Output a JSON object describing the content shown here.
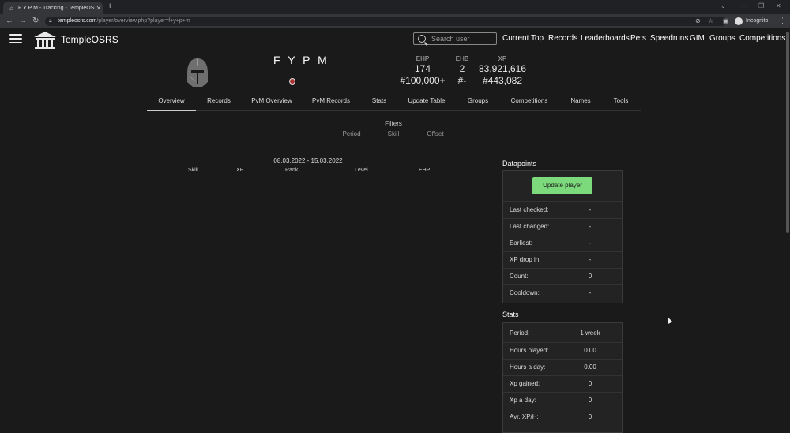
{
  "browser": {
    "tab_title": "F Y P M - Tracking - TempleOSRS",
    "url_host": "templeosrs.com",
    "url_path": "/player/overview.php?player=f+y+p+m",
    "incognito_label": "Incognito"
  },
  "site": {
    "brand": "TempleOSRS",
    "search_placeholder": "Search user",
    "nav": [
      "Current Top",
      "Records",
      "Leaderboards",
      "Pets",
      "Speedruns",
      "GIM",
      "Groups",
      "Competitions"
    ]
  },
  "player": {
    "name": "F Y P M",
    "stats": [
      {
        "label": "EHP",
        "value": "174",
        "rank": "#100,000+"
      },
      {
        "label": "EHB",
        "value": "2",
        "rank": "#-"
      },
      {
        "label": "XP",
        "value": "83,921,616",
        "rank": "#443,082"
      }
    ]
  },
  "tabs": [
    "Overview",
    "Records",
    "PvM Overview",
    "PvM Records",
    "Stats",
    "Update Table",
    "Groups",
    "Competitions",
    "Names",
    "Tools"
  ],
  "filters": {
    "title": "Filters",
    "items": [
      "Period",
      "Skill",
      "Offset"
    ]
  },
  "table": {
    "date_range": "08.03.2022 - 15.03.2022",
    "columns": [
      "Skill",
      "XP",
      "Rank",
      "Level",
      "EHP"
    ]
  },
  "datapoints": {
    "title": "Datapoints",
    "button": "Update player",
    "rows": [
      {
        "label": "Last checked:",
        "value": "-"
      },
      {
        "label": "Last changed:",
        "value": "-"
      },
      {
        "label": "Earliest:",
        "value": "-"
      },
      {
        "label": "XP drop in:",
        "value": "-"
      },
      {
        "label": "Count:",
        "value": "0"
      },
      {
        "label": "Cooldown:",
        "value": "-"
      }
    ]
  },
  "stats_panel": {
    "title": "Stats",
    "rows": [
      {
        "label": "Period:",
        "value": "1 week"
      },
      {
        "label": "Hours played:",
        "value": "0.00"
      },
      {
        "label": "Hours a day:",
        "value": "0.00"
      },
      {
        "label": "Xp gained:",
        "value": "0"
      },
      {
        "label": "Xp a day:",
        "value": "0"
      },
      {
        "label": "Avr. XP/H:",
        "value": "0"
      }
    ]
  }
}
